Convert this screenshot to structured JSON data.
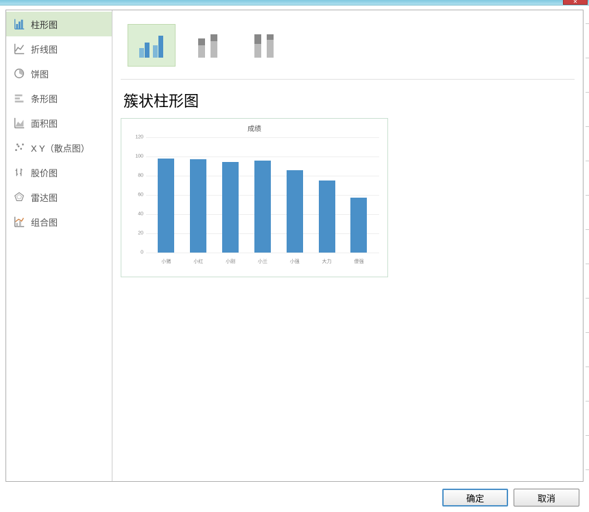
{
  "sidebar": {
    "items": [
      {
        "label": "柱形图",
        "icon": "bar-chart-icon"
      },
      {
        "label": "折线图",
        "icon": "line-chart-icon"
      },
      {
        "label": "饼图",
        "icon": "pie-chart-icon"
      },
      {
        "label": "条形图",
        "icon": "hbar-chart-icon"
      },
      {
        "label": "面积图",
        "icon": "area-chart-icon"
      },
      {
        "label": "X Y（散点图）",
        "icon": "scatter-chart-icon"
      },
      {
        "label": "股价图",
        "icon": "stock-chart-icon"
      },
      {
        "label": "雷达图",
        "icon": "radar-chart-icon"
      },
      {
        "label": "组合图",
        "icon": "combo-chart-icon"
      }
    ],
    "selected_index": 0
  },
  "subtypes": {
    "selected_index": 0,
    "items": [
      "clustered",
      "stacked",
      "stacked100"
    ]
  },
  "chart_title_label": "簇状柱形图",
  "buttons": {
    "ok": "确定",
    "cancel": "取消"
  },
  "chart_data": {
    "type": "bar",
    "title": "成绩",
    "xlabel": "",
    "ylabel": "",
    "ylim": [
      0,
      120
    ],
    "yticks": [
      0,
      20,
      40,
      60,
      80,
      100,
      120
    ],
    "categories": [
      "小猪",
      "小红",
      "小刚",
      "小兰",
      "小强",
      "大力",
      "傻强"
    ],
    "values": [
      98,
      97,
      94,
      96,
      86,
      75,
      57
    ]
  }
}
